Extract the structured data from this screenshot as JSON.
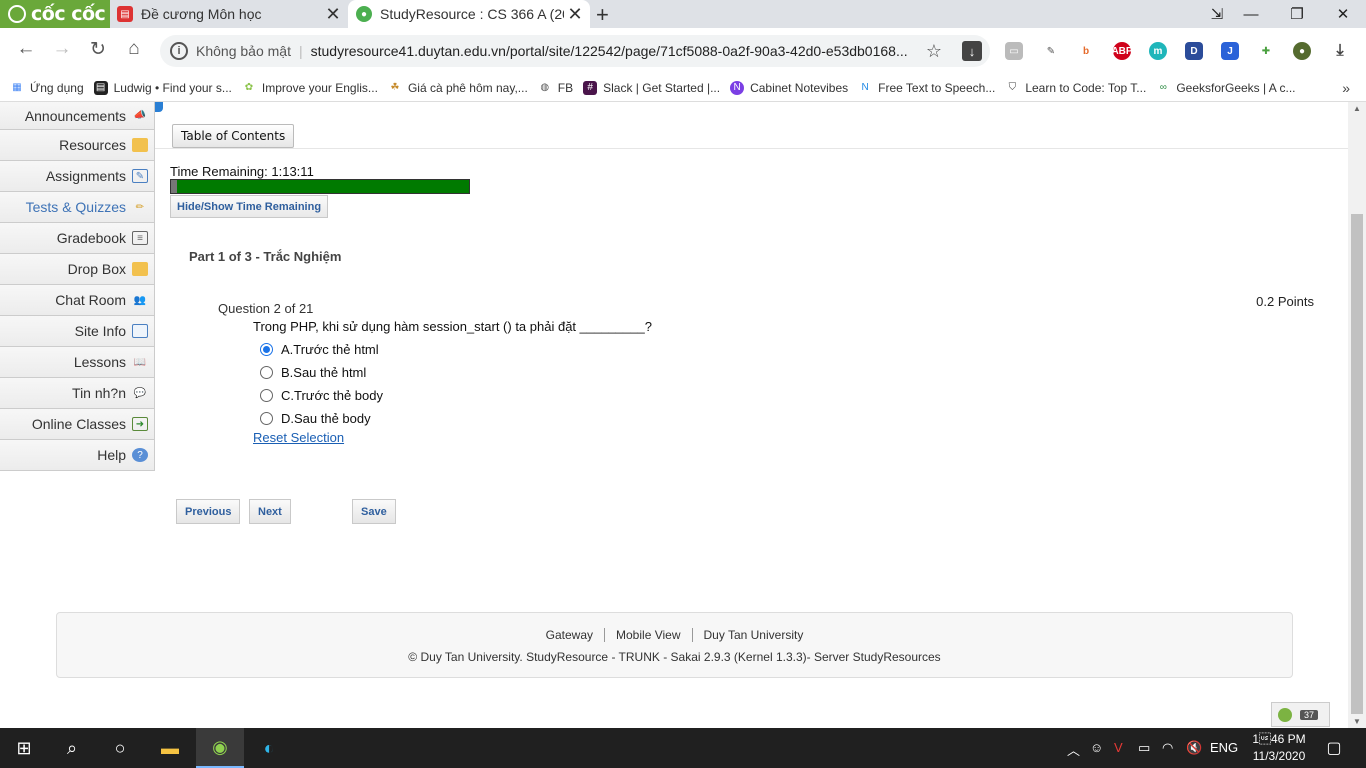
{
  "browser": {
    "brand": "cốc cốc",
    "tabs": [
      {
        "title": "Đề cương Môn học"
      },
      {
        "title": "StudyResource : CS 366 A (20"
      }
    ],
    "security_label": "Không bảo mật",
    "url": "studyresource41.duytan.edu.vn/portal/site/122542/page/71cf5088-0a2f-90a3-42d0-e53db0168...",
    "bookmarks": [
      {
        "label": "Ứng dụng",
        "icon": "apps-grid-icon"
      },
      {
        "label": "Ludwig • Find your s...",
        "icon": "ludwig-icon"
      },
      {
        "label": "Improve your Englis...",
        "icon": "english-icon"
      },
      {
        "label": "Giá cà phê hôm nay,...",
        "icon": "coffee-icon"
      },
      {
        "label": "FB",
        "icon": "fb-icon"
      },
      {
        "label": "Slack | Get Started |...",
        "icon": "slack-icon"
      },
      {
        "label": "Cabinet Notevibes",
        "icon": "notevibes-icon"
      },
      {
        "label": "Free Text to Speech...",
        "icon": "tts-icon"
      },
      {
        "label": "Learn to Code: Top T...",
        "icon": "shield-icon"
      },
      {
        "label": "GeeksforGeeks | A c...",
        "icon": "gfg-icon"
      }
    ]
  },
  "sidebar": {
    "items": [
      {
        "label": "Announcements",
        "icon": "megaphone-icon"
      },
      {
        "label": "Resources",
        "icon": "folder-icon"
      },
      {
        "label": "Assignments",
        "icon": "assignment-icon"
      },
      {
        "label": "Tests & Quizzes",
        "icon": "pencil-icon",
        "active": true
      },
      {
        "label": "Gradebook",
        "icon": "gradebook-icon"
      },
      {
        "label": "Drop Box",
        "icon": "dropbox-icon"
      },
      {
        "label": "Chat Room",
        "icon": "chat-icon"
      },
      {
        "label": "Site Info",
        "icon": "siteinfo-icon"
      },
      {
        "label": "Lessons",
        "icon": "book-icon"
      },
      {
        "label": "Tin nh?n",
        "icon": "message-icon"
      },
      {
        "label": "Online Classes",
        "icon": "online-class-icon"
      },
      {
        "label": "Help",
        "icon": "help-icon"
      }
    ]
  },
  "quiz": {
    "toc_label": "Table of Contents",
    "time_remaining": "Time Remaining: 1:13:11",
    "time_elapsed_fraction": 0.02,
    "hide_show_label": "Hide/Show Time Remaining",
    "part_title": "Part 1 of 3 - Trắc Nghiệm",
    "question_number": "Question 2 of 21",
    "points": "0.2 Points",
    "question_text": "Trong PHP, khi sử dụng hàm session_start () ta phải đặt _________?",
    "options": [
      {
        "label": "A.Trước thẻ html",
        "selected": true
      },
      {
        "label": "B.Sau thẻ html",
        "selected": false
      },
      {
        "label": "C.Trước thẻ body",
        "selected": false
      },
      {
        "label": "D.Sau thẻ body",
        "selected": false
      }
    ],
    "reset_label": "Reset Selection",
    "buttons": {
      "previous": "Previous",
      "next": "Next",
      "save": "Save"
    }
  },
  "footer": {
    "links": [
      "Gateway",
      "Mobile View",
      "Duy Tan University"
    ],
    "copyright": "© Duy Tan University. StudyResource - TRUNK - Sakai 2.9.3 (Kernel 1.3.3)- Server StudyResources"
  },
  "presence": {
    "count": "37"
  },
  "taskbar": {
    "language": "ENG",
    "time": "1\u001f46 PM",
    "date": "11/3/2020"
  },
  "colors": {
    "progress_fill": "#007a00",
    "link_blue": "#1a5fb4",
    "sidebar_active": "#3e73b6"
  }
}
